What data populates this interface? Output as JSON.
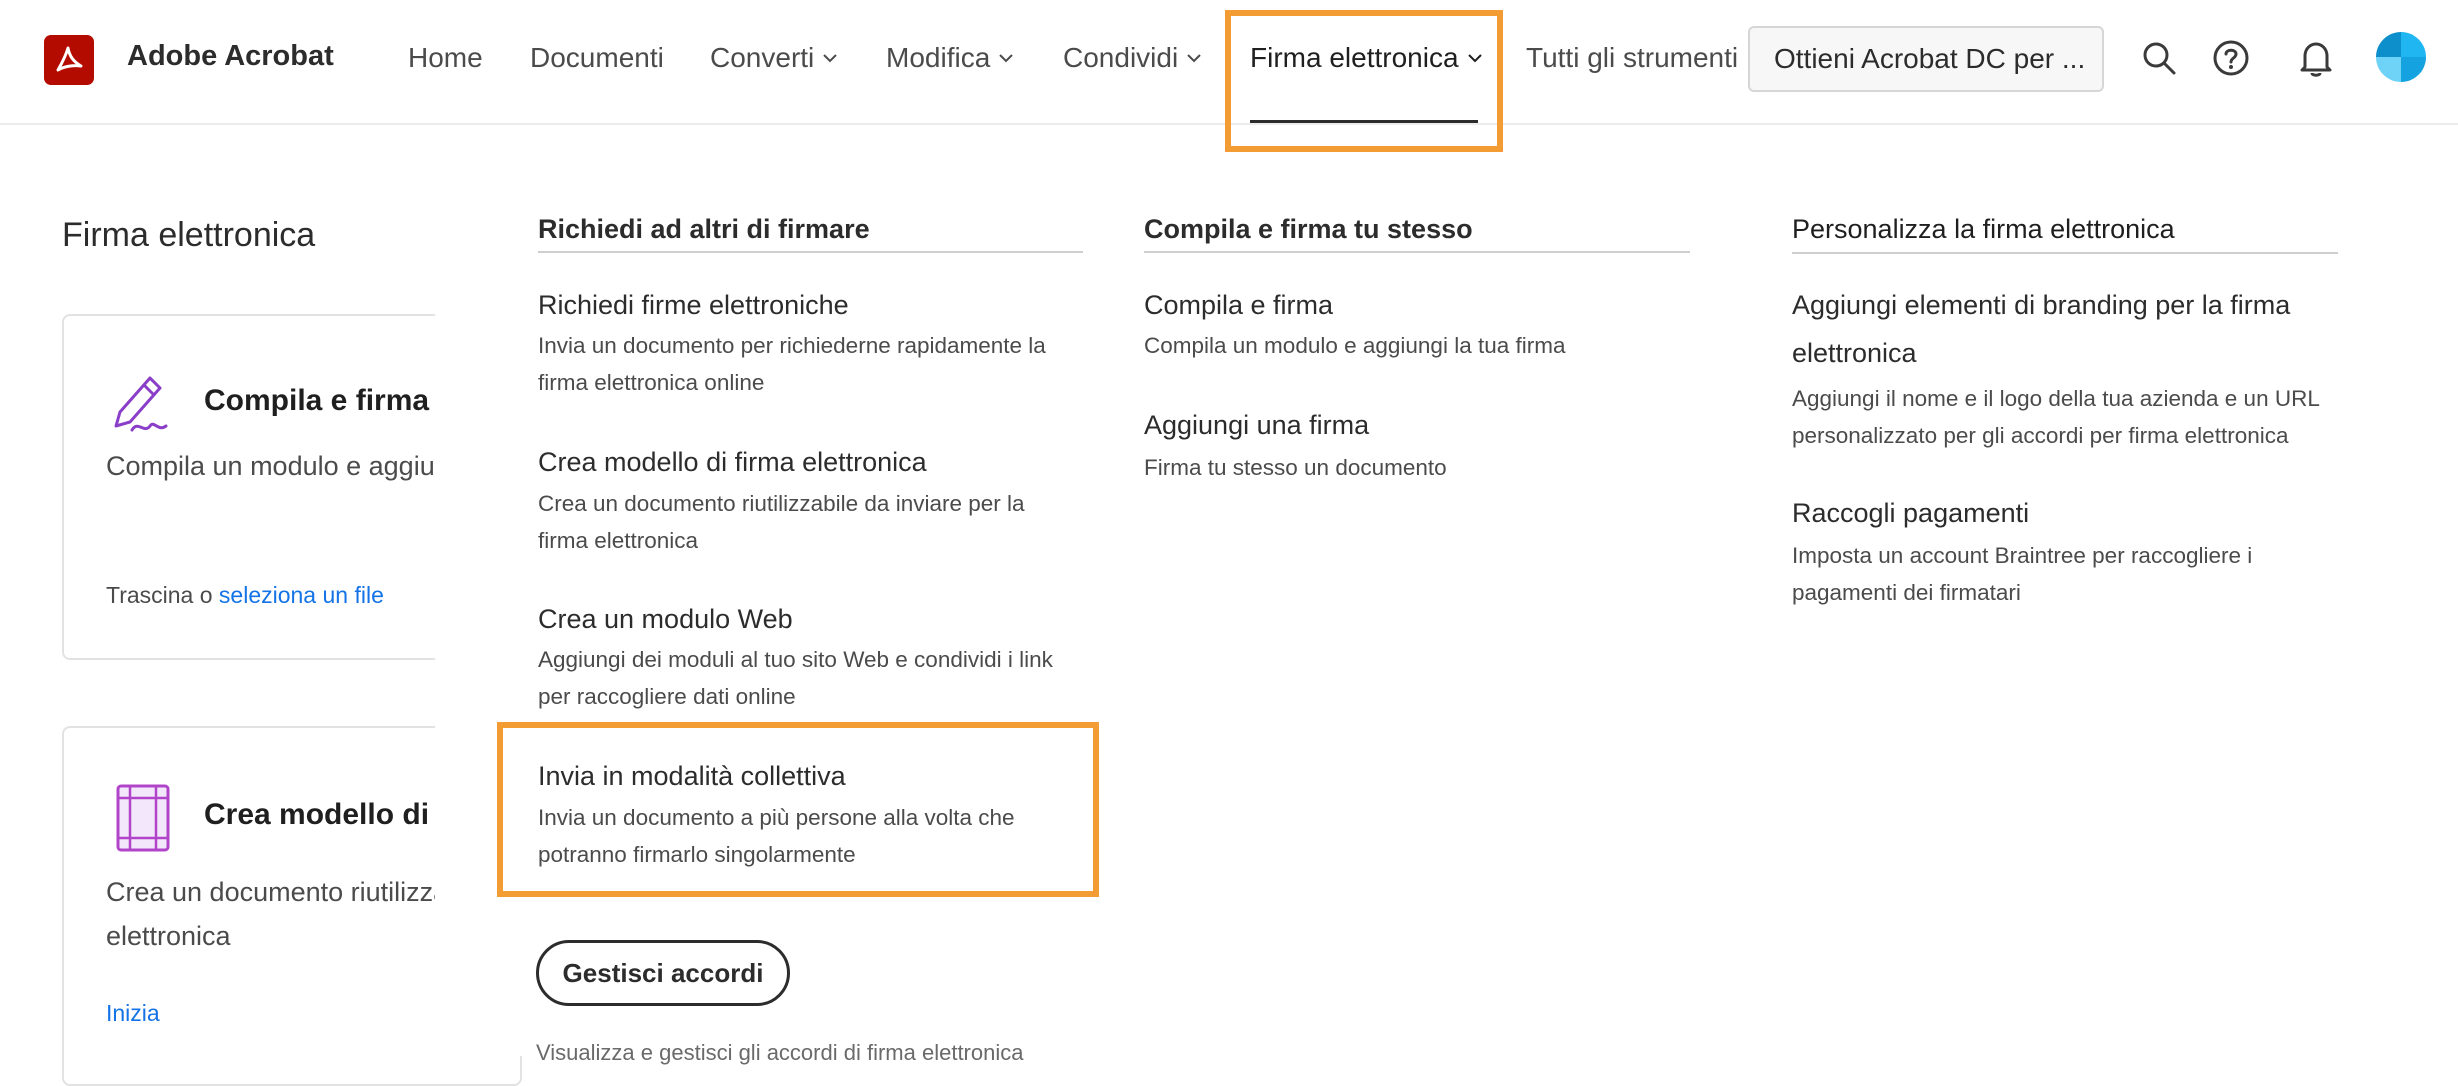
{
  "app": {
    "name": "Adobe Acrobat"
  },
  "nav": {
    "items": [
      {
        "label": "Home",
        "has_menu": false
      },
      {
        "label": "Documenti",
        "has_menu": false
      },
      {
        "label": "Converti",
        "has_menu": true
      },
      {
        "label": "Modifica",
        "has_menu": true
      },
      {
        "label": "Condividi",
        "has_menu": true
      },
      {
        "label": "Firma elettronica",
        "has_menu": true,
        "active": true
      },
      {
        "label": "Tutti gli strumenti",
        "has_menu": false
      }
    ],
    "get_acrobat_label": "Ottieni Acrobat DC per ...",
    "icons": [
      "search-icon",
      "help-icon",
      "bell-icon",
      "avatar"
    ]
  },
  "left": {
    "title": "Firma elettronica",
    "cards": [
      {
        "title": "Compila e firma",
        "desc": "Compila un modulo e aggiungi la tua firma",
        "link_prefix": "Trascina o",
        "link_label": "seleziona un file",
        "icon": "pen-sign-icon"
      },
      {
        "title": "Crea modello di firma elettronica",
        "desc_lines": [
          "Crea un documento riutilizzabile da inviare per la firma",
          "elettronica"
        ],
        "link_label": "Inizia",
        "icon": "template-icon"
      }
    ]
  },
  "menu": {
    "columns": [
      {
        "heading": "Richiedi ad altri di firmare",
        "items": [
          {
            "title": "Richiedi firme elettroniche",
            "desc": "Invia un documento per richiederne rapidamente la firma elettronica online"
          },
          {
            "title": "Crea modello di firma elettronica",
            "desc": "Crea un documento riutilizzabile da inviare per la firma elettronica"
          },
          {
            "title": "Crea un modulo Web",
            "desc": "Aggiungi dei moduli al tuo sito Web e condividi i link per raccogliere dati online"
          },
          {
            "title": "Invia in modalità collettiva",
            "desc": "Invia un documento a più persone alla volta che potranno firmarlo singolarmente"
          }
        ],
        "button_label": "Gestisci accordi",
        "cut_text": "Visualizza e gestisci gli accordi di firma elettronica"
      },
      {
        "heading": "Compila e firma tu stesso",
        "items": [
          {
            "title": "Compila e firma",
            "desc": "Compila un modulo e aggiungi la tua firma"
          },
          {
            "title": "Aggiungi una firma",
            "desc": "Firma tu stesso un documento"
          }
        ]
      },
      {
        "heading": "Personalizza la firma elettronica",
        "items": [
          {
            "title": "Aggiungi elementi di branding per la firma elettronica",
            "desc": "Aggiungi il nome e il logo della tua azienda e un URL personalizzato per gli accordi per firma elettronica"
          },
          {
            "title": "Raccogli pagamenti",
            "desc": "Imposta un account Braintree per raccogliere i pagamenti dei firmatari"
          }
        ]
      }
    ]
  },
  "colors": {
    "highlight": "#f39c33",
    "link": "#1473e6",
    "brand": "#b30b00"
  }
}
